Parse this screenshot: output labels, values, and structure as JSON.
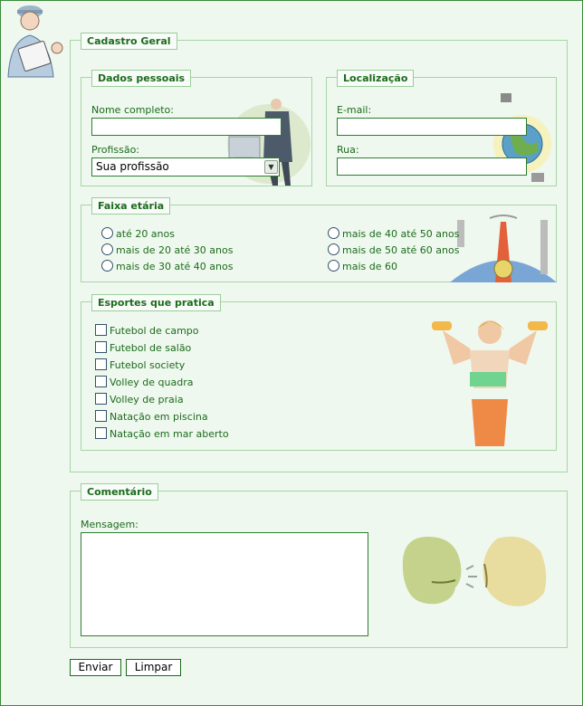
{
  "main_form": {
    "legend": "Cadastro Geral"
  },
  "dados_pessoais": {
    "legend": "Dados pessoais",
    "nome_label": "Nome completo:",
    "nome_value": "",
    "profissao_label": "Profissão:",
    "profissao_selected": "Sua profissão"
  },
  "localizacao": {
    "legend": "Localização",
    "email_label": "E-mail:",
    "email_value": "",
    "rua_label": "Rua:",
    "rua_value": ""
  },
  "faixa_etaria": {
    "legend": "Faixa etária",
    "options": [
      "até 20 anos",
      "mais de 20 até 30 anos",
      "mais de 30 até 40 anos",
      "mais de 40 até 50 anos",
      "mais de 50 até 60 anos",
      "mais de 60"
    ]
  },
  "esportes": {
    "legend": "Esportes que pratica",
    "options": [
      "Futebol de campo",
      "Futebol de salão",
      "Futebol society",
      "Volley de quadra",
      "Volley de praia",
      "Natação em piscina",
      "Natação em mar aberto"
    ]
  },
  "comentario": {
    "legend": "Comentário",
    "mensagem_label": "Mensagem:",
    "mensagem_value": ""
  },
  "actions": {
    "enviar": "Enviar",
    "limpar": "Limpar"
  },
  "colors": {
    "text": "#1c6b1c",
    "border": "#a6d6a6",
    "background": "#eef8ee",
    "input_border": "#2e7d32"
  }
}
